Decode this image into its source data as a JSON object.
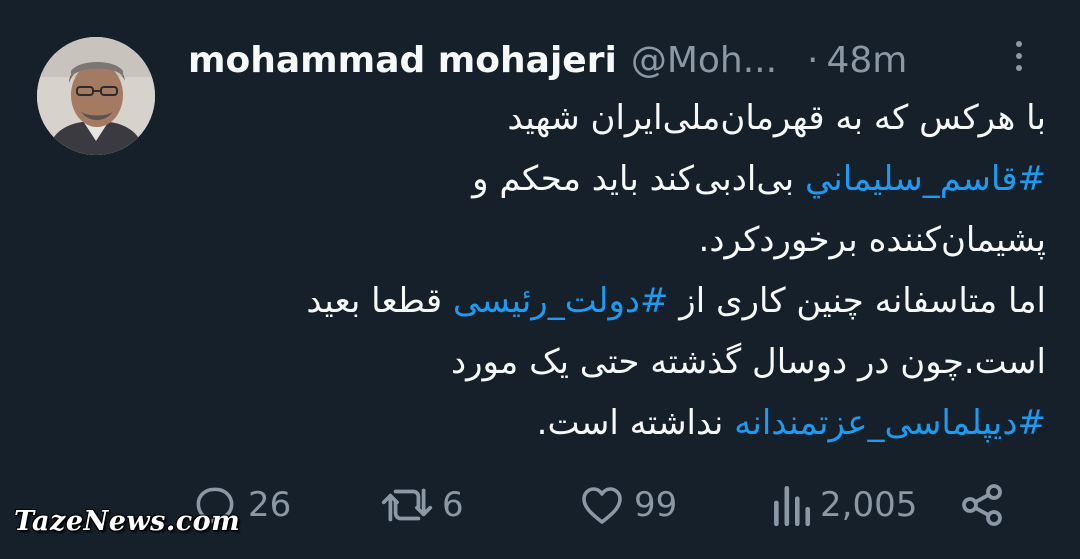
{
  "tweet": {
    "display_name": "mohammad mohajeri",
    "handle": "@Moh...",
    "separator": "·",
    "time": "48m",
    "lines": [
      [
        {
          "text": "با هرکس که به قهرمان‌ملی‌ایران شهید",
          "tag": false
        }
      ],
      [
        {
          "text": "#قاسم_سليماني",
          "tag": true
        },
        {
          "text": " بی‌ادبی‌کند باید محکم و",
          "tag": false
        }
      ],
      [
        {
          "text": "پشیمان‌کننده برخوردکرد.",
          "tag": false
        }
      ],
      [
        {
          "text": "اما متاسفانه چنین کاری از ",
          "tag": false
        },
        {
          "text": "#دولت_رئیسی",
          "tag": true
        },
        {
          "text": " قطعا بعید",
          "tag": false
        }
      ],
      [
        {
          "text": "است.چون در دوسال گذشته حتی یک مورد",
          "tag": false
        }
      ],
      [
        {
          "text": "#دیپلماسی_عزتمندانه",
          "tag": true
        },
        {
          "text": " نداشته است.",
          "tag": false
        }
      ]
    ]
  },
  "actions": {
    "reply_count": "26",
    "retweet_count": "6",
    "like_count": "99",
    "views_count": "2,005"
  },
  "icons": {
    "avatar": "profile-photo",
    "more": "more-vertical-icon",
    "reply": "reply-icon",
    "retweet": "retweet-icon",
    "like": "heart-icon",
    "views": "views-icon",
    "share": "share-icon"
  },
  "colors": {
    "background": "#15202b",
    "text": "#f7f9f9",
    "muted": "#8b98a5",
    "hashtag": "#1d9bf0"
  },
  "watermark": "TazeNews.com"
}
